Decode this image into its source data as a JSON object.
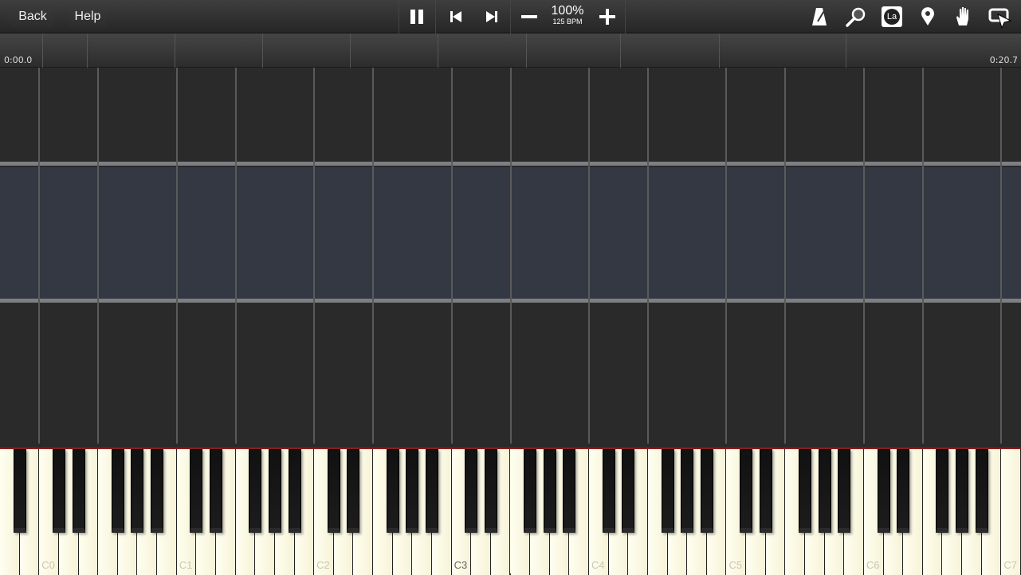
{
  "toolbar": {
    "back_label": "Back",
    "help_label": "Help",
    "speed_percent": "100%",
    "bpm": "125 BPM",
    "icons": [
      "pause-icon",
      "skip-back-icon",
      "skip-forward-icon",
      "minus-icon",
      "plus-icon",
      "metronome-icon",
      "magnifier-icon",
      "note-labels-icon",
      "location-pin-icon",
      "hand-icon",
      "keyboard-display-icon"
    ],
    "note_label_icon_text": "La"
  },
  "timeline": {
    "start_time": "0:00.0",
    "end_time": "0:20.7"
  },
  "keyboard": {
    "octave_labels": [
      "C0",
      "C1",
      "C2",
      "C3",
      "C4",
      "C5",
      "C6",
      "C7"
    ],
    "middle_label": "C3"
  },
  "colors": {
    "background": "#2a2a2a",
    "highlight_band": "#333842",
    "keyboard_top": "#8a1d1d"
  }
}
